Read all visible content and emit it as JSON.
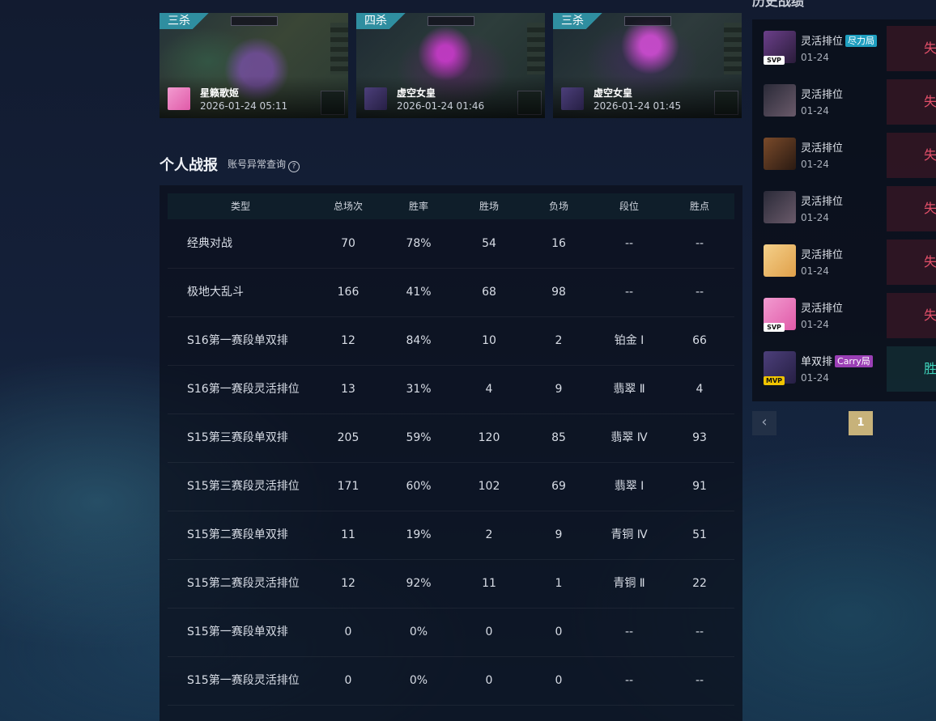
{
  "clips": [
    {
      "tag": "三杀",
      "hero": "星籁歌姬",
      "time": "2026-01-24 05:11",
      "tag_color": "#2f8ea0"
    },
    {
      "tag": "四杀",
      "hero": "虚空女皇",
      "time": "2026-01-24 01:46",
      "tag_color": "#2f8ea0"
    },
    {
      "tag": "三杀",
      "hero": "虚空女皇",
      "time": "2026-01-24 01:45",
      "tag_color": "#2f8ea0"
    }
  ],
  "personal": {
    "title": "个人战报",
    "link": "账号异常查询",
    "help_icon": "?"
  },
  "table": {
    "headers": [
      "类型",
      "总场次",
      "胜率",
      "胜场",
      "负场",
      "段位",
      "胜点"
    ],
    "rows": [
      [
        "经典对战",
        "70",
        "78%",
        "54",
        "16",
        "--",
        "--"
      ],
      [
        "极地大乱斗",
        "166",
        "41%",
        "68",
        "98",
        "--",
        "--"
      ],
      [
        "S16第一赛段单双排",
        "12",
        "84%",
        "10",
        "2",
        "铂金 Ⅰ",
        "66"
      ],
      [
        "S16第一赛段灵活排位",
        "13",
        "31%",
        "4",
        "9",
        "翡翠 Ⅱ",
        "4"
      ],
      [
        "S15第三赛段单双排",
        "205",
        "59%",
        "120",
        "85",
        "翡翠 Ⅳ",
        "93"
      ],
      [
        "S15第三赛段灵活排位",
        "171",
        "60%",
        "102",
        "69",
        "翡翠 Ⅰ",
        "91"
      ],
      [
        "S15第二赛段单双排",
        "11",
        "19%",
        "2",
        "9",
        "青铜 Ⅳ",
        "51"
      ],
      [
        "S15第二赛段灵活排位",
        "12",
        "92%",
        "11",
        "1",
        "青铜 Ⅱ",
        "22"
      ],
      [
        "S15第一赛段单双排",
        "0",
        "0%",
        "0",
        "0",
        "--",
        "--"
      ],
      [
        "S15第一赛段灵活排位",
        "0",
        "0%",
        "0",
        "0",
        "--",
        "--"
      ]
    ]
  },
  "history": {
    "title": "历史战绩",
    "items": [
      {
        "mode": "灵活排位",
        "tag": "尽力局",
        "tag_color": "#1f9fc0",
        "date": "01-24",
        "badge": "SVP",
        "result": "失",
        "outcome": "lose"
      },
      {
        "mode": "灵活排位",
        "tag": "",
        "tag_color": "",
        "date": "01-24",
        "badge": "",
        "result": "失",
        "outcome": "lose"
      },
      {
        "mode": "灵活排位",
        "tag": "",
        "tag_color": "",
        "date": "01-24",
        "badge": "",
        "result": "失",
        "outcome": "lose"
      },
      {
        "mode": "灵活排位",
        "tag": "",
        "tag_color": "",
        "date": "01-24",
        "badge": "",
        "result": "失",
        "outcome": "lose"
      },
      {
        "mode": "灵活排位",
        "tag": "",
        "tag_color": "",
        "date": "01-24",
        "badge": "",
        "result": "失",
        "outcome": "lose"
      },
      {
        "mode": "灵活排位",
        "tag": "",
        "tag_color": "",
        "date": "01-24",
        "badge": "SVP",
        "result": "失",
        "outcome": "lose"
      },
      {
        "mode": "单双排",
        "tag": "Carry局",
        "tag_color": "#9b3fb5",
        "date": "01-24",
        "badge": "MVP",
        "result": "胜",
        "outcome": "win"
      }
    ]
  },
  "pagination": {
    "prev": "‹",
    "current": "1"
  }
}
